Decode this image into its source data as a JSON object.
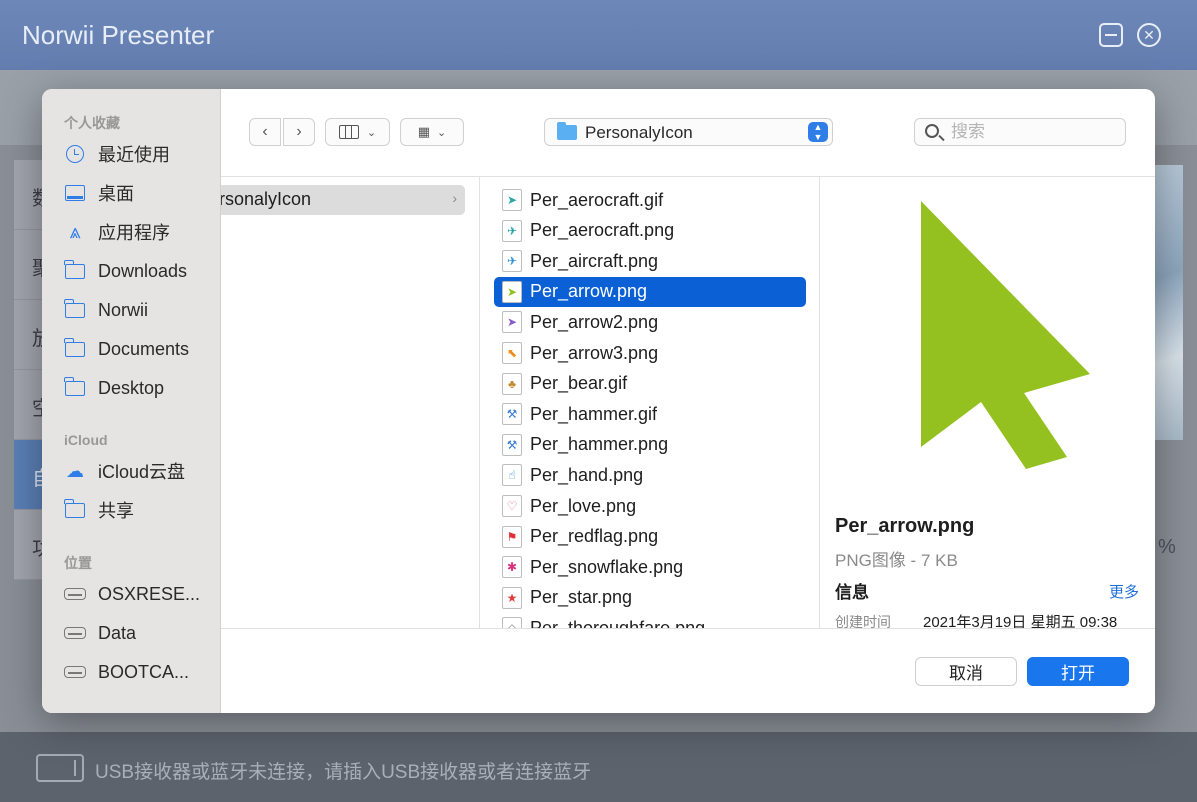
{
  "app": {
    "title": "Norwii Presenter",
    "left_fragments": [
      "数",
      "聚",
      "放",
      "空",
      "自",
      "功"
    ],
    "status_text": "USB接收器或蓝牙未连接，请插入USB接收器或者连接蓝牙",
    "right_fragment": "%"
  },
  "sidebar": {
    "sections": {
      "favorites": "个人收藏",
      "icloud": "iCloud",
      "locations": "位置"
    },
    "favorites": [
      {
        "label": "最近使用",
        "icon": "clock-icon"
      },
      {
        "label": "桌面",
        "icon": "desktop-icon"
      },
      {
        "label": "应用程序",
        "icon": "applications-icon"
      },
      {
        "label": "Downloads",
        "icon": "folder-icon"
      },
      {
        "label": "Norwii",
        "icon": "folder-icon"
      },
      {
        "label": "Documents",
        "icon": "folder-icon"
      },
      {
        "label": "Desktop",
        "icon": "folder-icon"
      }
    ],
    "icloud": [
      {
        "label": "iCloud云盘",
        "icon": "cloud-icon"
      },
      {
        "label": "共享",
        "icon": "shared-folder-icon"
      }
    ],
    "locations": [
      {
        "label": "OSXRESE...",
        "icon": "disk-icon"
      },
      {
        "label": "Data",
        "icon": "disk-icon"
      },
      {
        "label": "BOOTCA...",
        "icon": "disk-icon"
      }
    ]
  },
  "toolbar": {
    "back": "‹",
    "forward": "›",
    "current_folder": "PersonalyIcon",
    "search_placeholder": "搜索"
  },
  "column1": {
    "item": "PersonalyIcon"
  },
  "files": [
    {
      "name": "Per_aerocraft.gif",
      "icon_color": "#2aa6a6",
      "glyph": "➤"
    },
    {
      "name": "Per_aerocraft.png",
      "icon_color": "#20a0a8",
      "glyph": "✈"
    },
    {
      "name": "Per_aircraft.png",
      "icon_color": "#2b8fd8",
      "glyph": "✈"
    },
    {
      "name": "Per_arrow.png",
      "icon_color": "#8cc21e",
      "glyph": "➤"
    },
    {
      "name": "Per_arrow2.png",
      "icon_color": "#8a5bc8",
      "glyph": "➤"
    },
    {
      "name": "Per_arrow3.png",
      "icon_color": "#f08c1a",
      "glyph": "⬉"
    },
    {
      "name": "Per_bear.gif",
      "icon_color": "#c08a30",
      "glyph": "♣"
    },
    {
      "name": "Per_hammer.gif",
      "icon_color": "#3a7ed8",
      "glyph": "⚒"
    },
    {
      "name": "Per_hammer.png",
      "icon_color": "#3a7ed8",
      "glyph": "⚒"
    },
    {
      "name": "Per_hand.png",
      "icon_color": "#2f8fd8",
      "glyph": "☝"
    },
    {
      "name": "Per_love.png",
      "icon_color": "#e0607a",
      "glyph": "♡"
    },
    {
      "name": "Per_redflag.png",
      "icon_color": "#e0303a",
      "glyph": "⚑"
    },
    {
      "name": "Per_snowflake.png",
      "icon_color": "#d8307a",
      "glyph": "✱"
    },
    {
      "name": "Per_star.png",
      "icon_color": "#e03a3a",
      "glyph": "★"
    },
    {
      "name": "Per_thoroughfare.png",
      "icon_color": "#888888",
      "glyph": "◇"
    }
  ],
  "selected_file_index": 3,
  "preview": {
    "name": "Per_arrow.png",
    "type": "PNG图像 - 7 KB",
    "info_label": "信息",
    "more_label": "更多",
    "created_label": "创建时间",
    "created_value": "2021年3月19日 星期五 09:38",
    "arrow_color": "#94c11f"
  },
  "buttons": {
    "cancel": "取消",
    "open": "打开"
  }
}
